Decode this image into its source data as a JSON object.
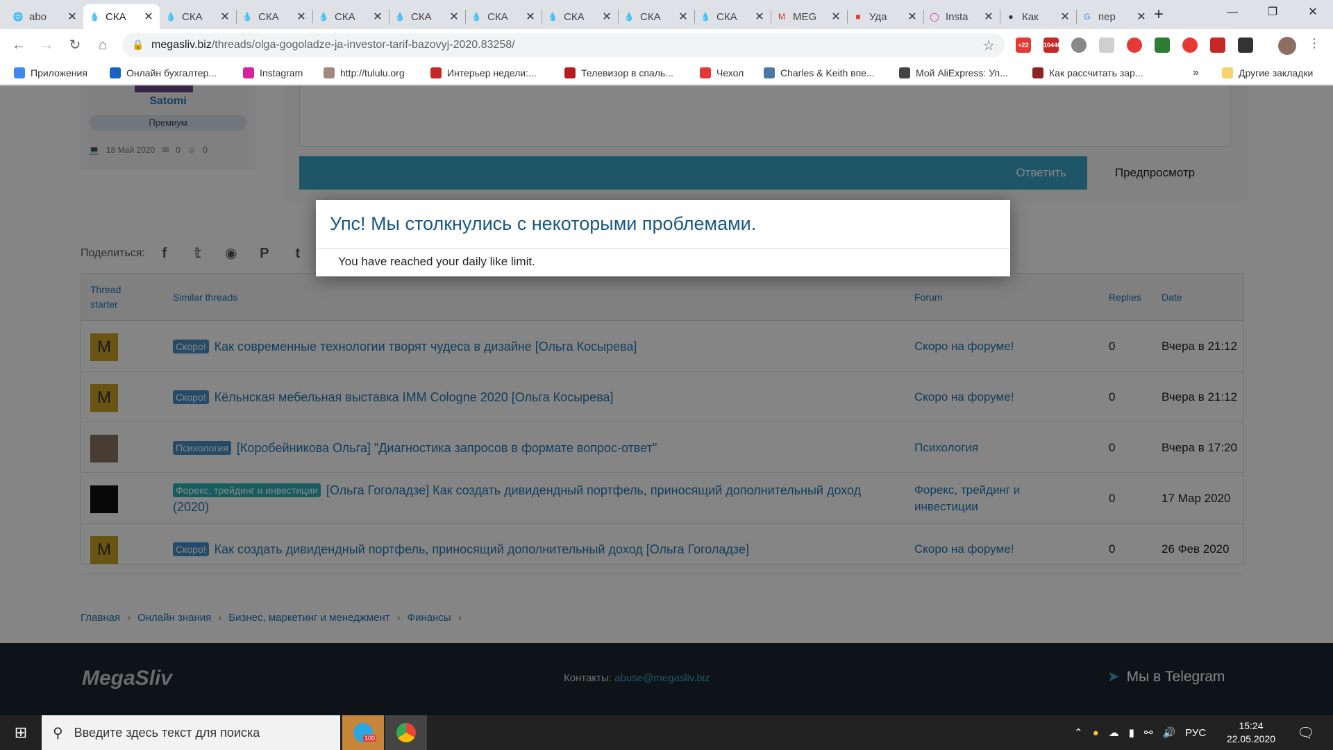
{
  "browser": {
    "tabs": [
      {
        "title": "abo",
        "icon": "globe"
      },
      {
        "title": "СКА",
        "icon": "drop",
        "active": true
      },
      {
        "title": "СКА",
        "icon": "drop"
      },
      {
        "title": "СКА",
        "icon": "drop"
      },
      {
        "title": "СКА",
        "icon": "drop"
      },
      {
        "title": "СКА",
        "icon": "drop"
      },
      {
        "title": "СКА",
        "icon": "drop"
      },
      {
        "title": "СКА",
        "icon": "drop"
      },
      {
        "title": "СКА",
        "icon": "drop"
      },
      {
        "title": "СКА",
        "icon": "drop"
      },
      {
        "title": "MEG",
        "icon": "gmail"
      },
      {
        "title": "Уда",
        "icon": "red-square"
      },
      {
        "title": "Insta",
        "icon": "instagram"
      },
      {
        "title": "Как",
        "icon": "dark-circle"
      },
      {
        "title": "пер",
        "icon": "google"
      }
    ],
    "url_domain": "megasliv.biz",
    "url_path": "/threads/olga-gogoladze-ja-investor-tarif-bazovyj-2020.83258/",
    "extension_badges": [
      "+22",
      "10446"
    ],
    "bookmarks": [
      {
        "label": "Приложения",
        "color": "#4285f4"
      },
      {
        "label": "Онлайн бухгалтер...",
        "color": "#1565c0"
      },
      {
        "label": "Instagram",
        "color": "#d6249f"
      },
      {
        "label": "http://tululu.org",
        "color": "#a1887f"
      },
      {
        "label": "Интерьер недели:...",
        "color": "#c62828"
      },
      {
        "label": "Телевизор в спаль...",
        "color": "#b71c1c"
      },
      {
        "label": "Чехол",
        "color": "#e53935"
      },
      {
        "label": "Charles & Keith впе...",
        "color": "#4a76a8"
      },
      {
        "label": "Мой AliExpress: Уп...",
        "color": "#444444"
      },
      {
        "label": "Как рассчитать зар...",
        "color": "#8e2424"
      }
    ],
    "bookmarks_more": "»",
    "other_bookmarks": "Другие закладки"
  },
  "user": {
    "name": "Satomi",
    "badge": "Премиум",
    "joined": "18 Май 2020",
    "messages": "0",
    "reactions": "0"
  },
  "editor": {
    "reply_label": "Ответить",
    "preview_label": "Предпросмотр"
  },
  "share": {
    "label": "Поделиться:",
    "icons": [
      "facebook-icon",
      "twitter-icon",
      "reddit-icon",
      "pinterest-icon",
      "tumblr-icon",
      "whatsapp-icon",
      "email-icon",
      "link-icon"
    ]
  },
  "similar": {
    "headers": {
      "starter": "Thread starter",
      "threads": "Similar threads",
      "forum": "Forum",
      "replies": "Replies",
      "date": "Date"
    },
    "rows": [
      {
        "avatar": "M",
        "avatar_color": "#c9a227",
        "tag": "Скоро!",
        "tag_color": "#4790c8",
        "title": "Как современные технологии творят чудеса в дизайне [Ольга Косырева]",
        "forum": "Скоро на форуме!",
        "replies": "0",
        "date": "Вчера в 21:12"
      },
      {
        "avatar": "M",
        "avatar_color": "#c9a227",
        "tag": "Скоро!",
        "tag_color": "#4790c8",
        "title": "Кёльнская мебельная выставка IMM Cologne 2020 [Ольга Косырева]",
        "forum": "Скоро на форуме!",
        "replies": "0",
        "date": "Вчера в 21:12"
      },
      {
        "avatar": "",
        "avatar_color": "#8a7560",
        "tag": "Психология",
        "tag_color": "#4790c8",
        "title": "[Коробейникова Ольга] \"Диагностика запросов в формате вопрос-ответ\"",
        "forum": "Психология",
        "replies": "0",
        "date": "Вчера в 17:20"
      },
      {
        "avatar": "",
        "avatar_color": "#111111",
        "tag": "Форекс, трейдинг и инвестиции",
        "tag_color": "#2bb3b8",
        "title": "[Ольга Гоголадзе] Как создать дивидендный портфель, приносящий дополнительный доход (2020)",
        "forum": "Форекс, трейдинг и инвестиции",
        "replies": "0",
        "date": "17 Мар 2020"
      },
      {
        "avatar": "M",
        "avatar_color": "#c9a227",
        "tag": "Скоро!",
        "tag_color": "#4790c8",
        "title": "Как создать дивидендный портфель, приносящий дополнительный доход [Ольга Гоголадзе]",
        "forum": "Скоро на форуме!",
        "replies": "0",
        "date": "26 Фев 2020"
      }
    ]
  },
  "breadcrumbs": [
    "Главная",
    "Онлайн знания",
    "Бизнес, маркетинг и менеджмент",
    "Финансы"
  ],
  "footer": {
    "logo": "MegaSliv",
    "contacts_label": "Контакты:",
    "contacts_email": "abuse@megasliv.biz",
    "telegram": "Мы в Telegram"
  },
  "modal": {
    "title": "Упс! Мы столкнулись с некоторыми проблемами.",
    "message": "You have reached your daily like limit."
  },
  "taskbar": {
    "search_placeholder": "Введите здесь текст для поиска",
    "telegram_badge": "100",
    "language": "РУС",
    "time": "15:24",
    "date": "22.05.2020"
  }
}
